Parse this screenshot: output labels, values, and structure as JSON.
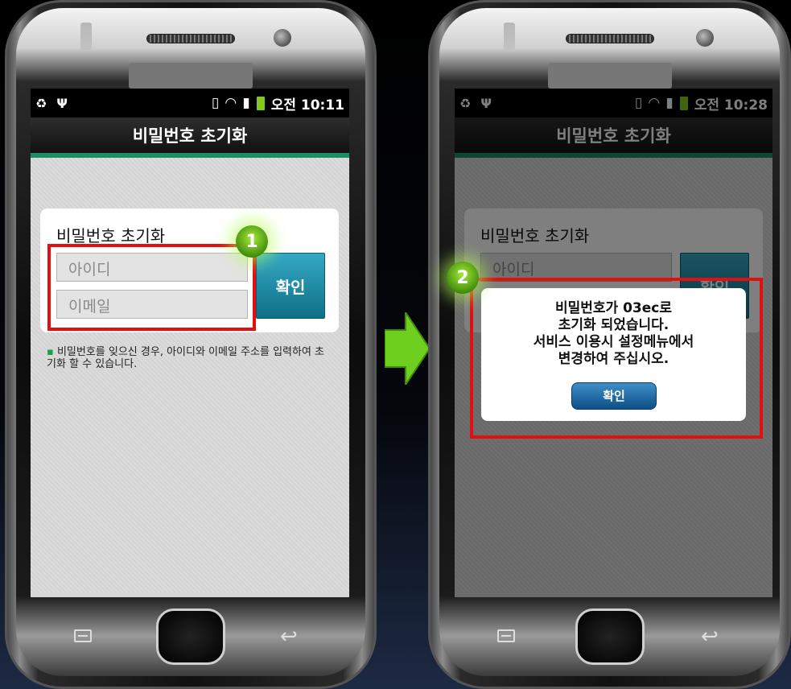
{
  "left_phone": {
    "status": {
      "icons_left": [
        "♻",
        "Ψ"
      ],
      "time": "오전 10:11"
    },
    "title": "비밀번호 초기화",
    "card": {
      "title": "비밀번호 초기화",
      "id_placeholder": "아이디",
      "email_placeholder": "이메일",
      "confirm_label": "확인"
    },
    "note": "비밀번호를 잊으신 경우, 아이디와 이메일 주소를 입력하여 초기화 할 수 있습니다.",
    "note_bullet": "▪"
  },
  "right_phone": {
    "status": {
      "icons_left": [
        "♻",
        "Ψ"
      ],
      "time": "오전 10:28"
    },
    "title": "비밀번호 초기화",
    "card": {
      "title": "비밀번호 초기화",
      "id_placeholder": "아이디",
      "confirm_label": "확인"
    },
    "dialog": {
      "lines": [
        "비밀번호가 03ec로",
        "초기화 되었습니다.",
        "서비스 이용시 설정메뉴에서",
        "변경하여 주십시오."
      ],
      "button": "확인"
    }
  },
  "steps": [
    "1",
    "2"
  ],
  "colors": {
    "accent_green": "#1c8c62",
    "highlight_red": "#e10f0f",
    "button_teal": "#1a8ba6",
    "arrow_green": "#6fcf1e"
  }
}
